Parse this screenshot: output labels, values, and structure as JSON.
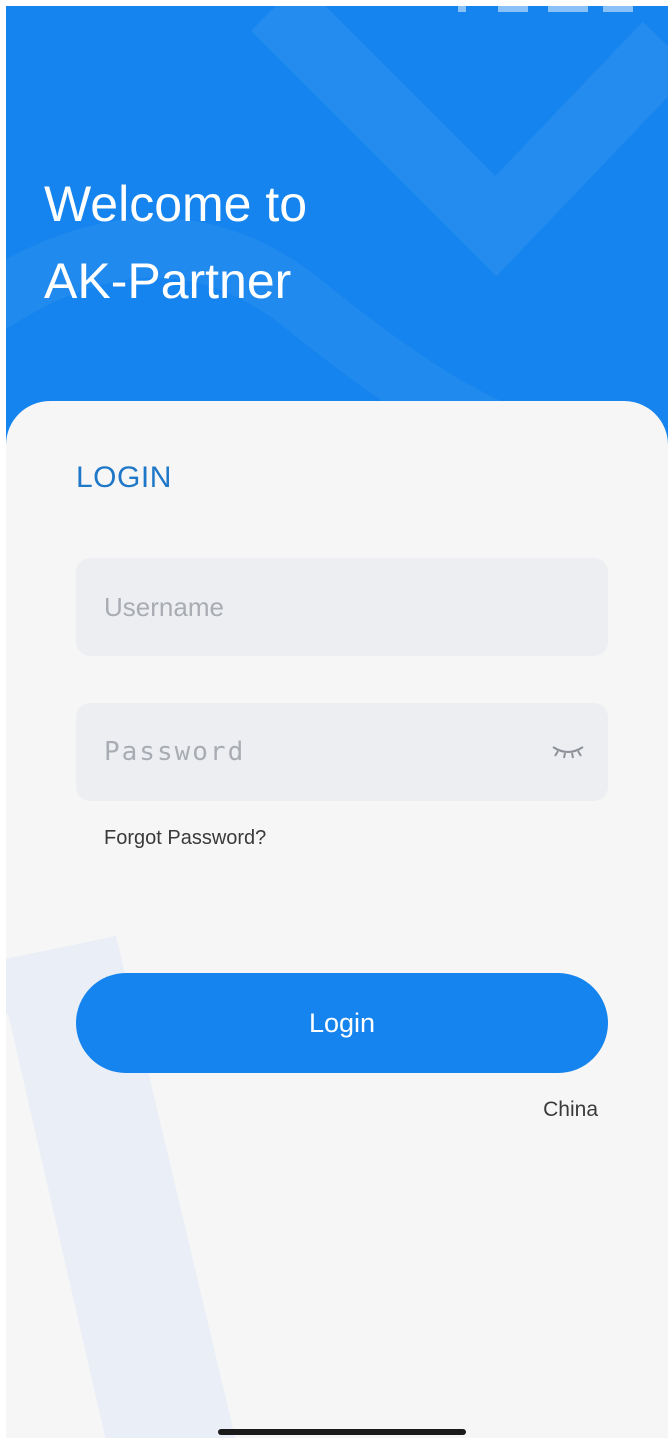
{
  "header": {
    "title_line1": "Welcome to",
    "title_line2": "AK-Partner",
    "background_color": "#1584ee"
  },
  "login_form": {
    "heading": "LOGIN",
    "username": {
      "placeholder": "Username",
      "value": ""
    },
    "password": {
      "placeholder": "Password",
      "value": "",
      "toggle_icon": "eye-closed-icon"
    },
    "forgot_password_label": "Forgot Password?",
    "submit_label": "Login",
    "region_label": "China"
  },
  "colors": {
    "accent": "#1584ee",
    "heading": "#1f77c8",
    "field_background": "#eceef2",
    "page_background": "#f6f6f6"
  }
}
